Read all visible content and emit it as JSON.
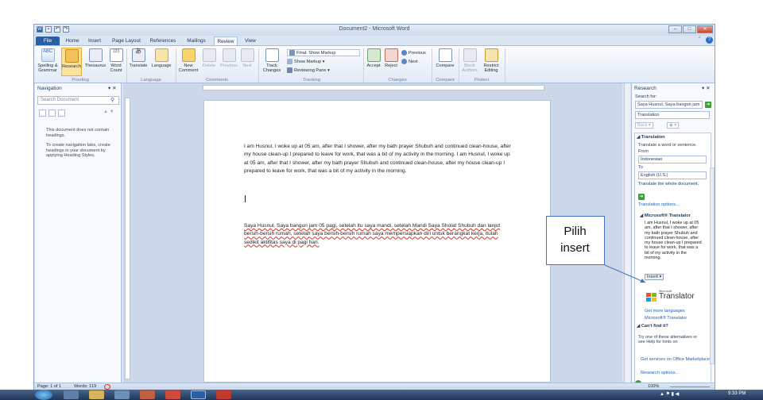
{
  "window": {
    "title": "Document2 - Microsoft Word"
  },
  "tabs": [
    "File",
    "Home",
    "Insert",
    "Page Layout",
    "References",
    "Mailings",
    "Review",
    "View"
  ],
  "ribbon": {
    "buttons": [
      {
        "label": "Spelling &",
        "label2": "Grammar",
        "icon": "spelling-icon"
      },
      {
        "label": "Research",
        "label2": "",
        "icon": "research-icon"
      },
      {
        "label": "Thesaurus",
        "label2": "",
        "icon": "thesaurus-icon"
      },
      {
        "label": "Word",
        "label2": "Count",
        "icon": "word-count-icon"
      },
      {
        "label": "Translate",
        "label2": "",
        "icon": "translate-icon"
      },
      {
        "label": "Language",
        "label2": "",
        "icon": "language-icon"
      },
      {
        "label": "New",
        "label2": "Comment",
        "icon": "new-comment-icon"
      },
      {
        "label": "Delete",
        "label2": "",
        "icon": "delete-icon"
      },
      {
        "label": "Previous",
        "label2": "",
        "icon": "previous-icon"
      },
      {
        "label": "Next",
        "label2": "",
        "icon": "next-icon"
      },
      {
        "label": "Track",
        "label2": "Changes",
        "icon": "track-changes-icon"
      },
      {
        "label": "Accept",
        "label2": "",
        "icon": "accept-icon"
      },
      {
        "label": "Reject",
        "label2": "",
        "icon": "reject-icon"
      },
      {
        "label": "Compare",
        "label2": "",
        "icon": "compare-icon"
      },
      {
        "label": "Block",
        "label2": "Authors",
        "icon": "block-authors-icon"
      },
      {
        "label": "Restrict",
        "label2": "Editing",
        "icon": "restrict-editing-icon"
      }
    ],
    "tracking": {
      "markup": "Final: Show Markup",
      "show": "Show Markup",
      "pane": "Reviewing Pane"
    },
    "changes": {
      "previous": "Previous",
      "next": "Next"
    },
    "groups": [
      "Proofing",
      "Language",
      "Comments",
      "Tracking",
      "Changes",
      "Compare",
      "Protect"
    ]
  },
  "nav": {
    "title": "Navigation",
    "search_placeholder": "Search Document",
    "msg1": "This document does not contain headings.",
    "msg2": "To create navigation tabs, create headings in your document by applying Heading Styles."
  },
  "document": {
    "para1": "I am Husnul, I woke up at 05 am, after that I shower, after my bath prayer Shubuh and continued clean-house, after my house clean-up I prepared to leave for work, that was a bit of my activity in the morning. I am Husnul, I woke up at 05 am, after that I shower, after my bath prayer Shubuh and continued clean-house, after my house clean-up I prepared to leave for work, that was a bit of my activity in the morning.",
    "para2": "Saya Husnul, Saya bangun jam 05 pagi, setelah itu saya mandi, setelah Mandi Saya Sholat Shubuh dan lanjut bersih-bersih rumah, setelah saya bersih-bersih rumah saya mempersiapkan diri untuk berangkat kerja, itulah sedikit aktifitas saya di pagi hari."
  },
  "research": {
    "title": "Research",
    "search_for_label": "Search for:",
    "search_value": "Saya Husnul, Saya bangun jam",
    "service": "Translation",
    "back": "Back",
    "section": "Translation",
    "desc": "Translate a word or sentence.",
    "from_label": "From",
    "from_value": "Indonesian",
    "to_label": "To",
    "to_value": "English (U.S.)",
    "whole": "Translate the whole document.",
    "options": "Translation options...",
    "mt_title": "Microsoft® Translator",
    "mt_text": "I am Husnul, I woke up at 05 am, after that I shower, after my bath prayer Shubuh and continued clean-house, after my house clean-up I prepared to leave for work, that was a bit of my activity in the morning.",
    "insert": "Insert",
    "logo_small": "Microsoft",
    "logo": "Translator",
    "more_lang": "Get more languages",
    "mt_link": "Microsoft® Translator",
    "cant": "Can't find it?",
    "try": "Try one of these alternatives or see Help for hints on",
    "office": "Get services on Office Marketplace",
    "ropts": "Research options..."
  },
  "status": {
    "page": "Page: 1 of 1",
    "words": "Words: 119",
    "zoom": "100%"
  },
  "taskbar": {
    "time": "9:33 PM"
  },
  "callout": {
    "line1": "Pilih",
    "line2": "insert"
  }
}
